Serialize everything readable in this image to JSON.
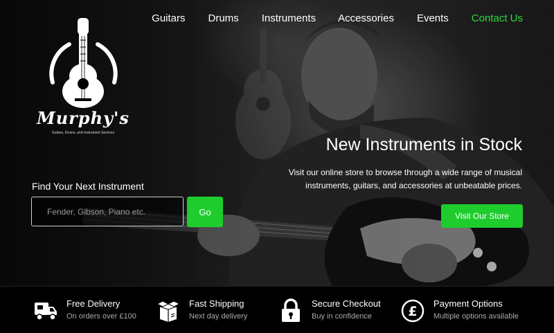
{
  "nav": {
    "items": [
      {
        "label": "Guitars"
      },
      {
        "label": "Drums"
      },
      {
        "label": "Instruments"
      },
      {
        "label": "Accessories"
      },
      {
        "label": "Events"
      },
      {
        "label": "Contact Us"
      }
    ],
    "active_color": "#2bdc3c"
  },
  "brand": {
    "name": "Murphy's",
    "tagline": "Guitars, Drums, and Instrument Services"
  },
  "search": {
    "label": "Find Your Next Instrument",
    "placeholder": "Fender, Gibson, Piano etc.",
    "value": "",
    "button_label": "Go"
  },
  "promo": {
    "title": "New Instruments in Stock",
    "text": "Visit our online store to browse through a wide range of musical instruments, guitars, and accessories at unbeatable prices.",
    "button_label": "Visit Our Store"
  },
  "features": [
    {
      "icon": "delivery-truck-icon",
      "title": "Free Delivery",
      "subtitle": "On orders over £100"
    },
    {
      "icon": "package-box-icon",
      "title": "Fast Shipping",
      "subtitle": "Next day delivery"
    },
    {
      "icon": "padlock-icon",
      "title": "Secure Checkout",
      "subtitle": "Buy in confidence"
    },
    {
      "icon": "pound-coin-icon",
      "title": "Payment Options",
      "subtitle": "Multiple options available"
    }
  ],
  "colors": {
    "accent": "#1fcc2e",
    "background": "#000000",
    "text": "#ffffff"
  }
}
